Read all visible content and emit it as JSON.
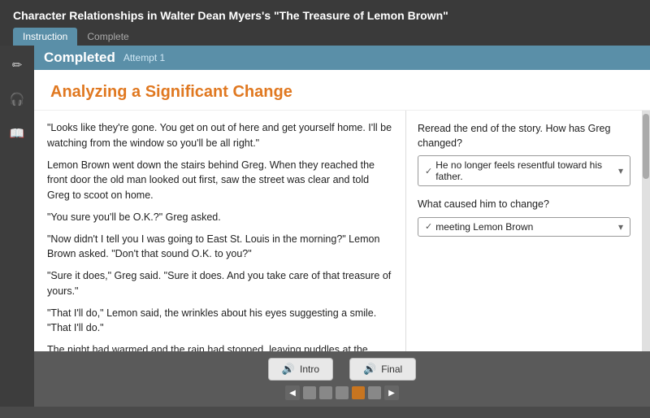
{
  "header": {
    "title": "Character Relationships in Walter Dean Myers's \"The Treasure of Lemon Brown\"",
    "tabs": [
      {
        "label": "Instruction",
        "active": true
      },
      {
        "label": "Complete",
        "active": false
      }
    ]
  },
  "status": {
    "label": "Completed",
    "attempt": "Attempt 1"
  },
  "lesson": {
    "title": "Analyzing a Significant Change",
    "text_paragraphs": [
      "\"Looks like they're gone. You get on out of here and get yourself home. I'll be watching from the window so you'll be all right.\"",
      "Lemon Brown went down the stairs behind Greg. When they reached the front door the old man looked out first, saw the street was clear and told Greg to scoot on home.",
      "\"You sure you'll be O.K.?\" Greg asked.",
      "\"Now didn't I tell you I was going to East St. Louis in the morning?\" Lemon Brown asked. \"Don't that sound O.K. to you?\"",
      "\"Sure it does,\" Greg said. \"Sure it does. And you take care of that treasure of yours.\"",
      "\"That I'll do,\" Lemon said, the wrinkles about his eyes suggesting a smile. \"That I'll do.\"",
      "The night had warmed and the rain had stopped, leaving puddles at the curbs. Greg didn't even want to think how late it was. He thought ahead of what his father would say..."
    ]
  },
  "questions": {
    "question1": {
      "label": "Reread the end of the story. How has Greg changed?",
      "answer": "He no longer feels resentful toward his father."
    },
    "question2": {
      "label": "What caused him to change?",
      "answer": "meeting Lemon Brown"
    }
  },
  "sidebar_icons": [
    {
      "name": "pencil-icon",
      "symbol": "✏"
    },
    {
      "name": "headphones-icon",
      "symbol": "🎧"
    },
    {
      "name": "book-icon",
      "symbol": "📖"
    }
  ],
  "audio_buttons": [
    {
      "label": "Intro",
      "name": "intro-button"
    },
    {
      "label": "Final",
      "name": "final-button"
    }
  ],
  "nav": {
    "dots": [
      {
        "active": false
      },
      {
        "active": false
      },
      {
        "active": false
      },
      {
        "active": true
      },
      {
        "active": false
      }
    ],
    "prev_label": "◀",
    "next_label": "▶"
  }
}
